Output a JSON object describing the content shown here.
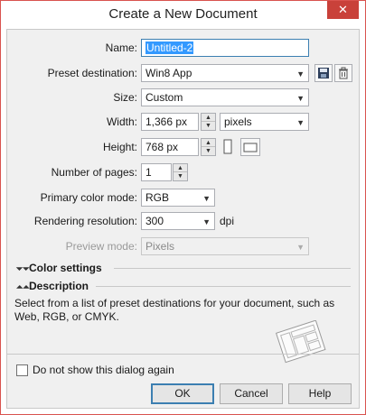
{
  "window": {
    "title": "Create a New Document",
    "close_glyph": "✕"
  },
  "form": {
    "name_label": "Name:",
    "name_value": "Untitled-2",
    "preset_label": "Preset destination:",
    "preset_value": "Win8 App",
    "size_label": "Size:",
    "size_value": "Custom",
    "width_label": "Width:",
    "width_value": "1,366 px",
    "units_value": "pixels",
    "height_label": "Height:",
    "height_value": "768 px",
    "pages_label": "Number of pages:",
    "pages_value": "1",
    "color_mode_label": "Primary color mode:",
    "color_mode_value": "RGB",
    "resolution_label": "Rendering resolution:",
    "resolution_value": "300",
    "resolution_unit": "dpi",
    "preview_label": "Preview mode:",
    "preview_value": "Pixels",
    "orientation": "landscape"
  },
  "sections": {
    "color_settings": "Color settings",
    "description": "Description",
    "description_text": "Select from a list of preset destinations for your document, such as Web, RGB, or CMYK."
  },
  "footer": {
    "dont_show_label": "Do not show this dialog again",
    "dont_show_checked": false,
    "ok_label": "OK",
    "cancel_label": "Cancel",
    "help_label": "Help"
  },
  "colors": {
    "close_red": "#c9413a",
    "selection_blue": "#3399ff",
    "focus_border": "#3c7fb1"
  }
}
